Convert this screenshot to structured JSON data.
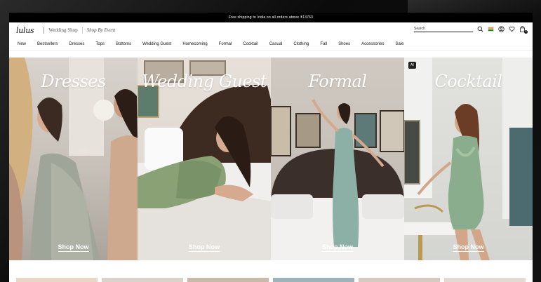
{
  "promo": {
    "text": "Free shipping to India on all orders above ₹13763"
  },
  "header": {
    "logo": "lulus",
    "links": [
      "Wedding Shop",
      "Shop By Event"
    ],
    "search_placeholder": "Search",
    "bag_count": "0"
  },
  "nav": {
    "items": [
      "New",
      "Bestsellers",
      "Dresses",
      "Tops",
      "Bottoms",
      "Wedding Guest",
      "Homecoming",
      "Formal",
      "Cocktail",
      "Casual",
      "Clothing",
      "Fall",
      "Shoes",
      "Accessories",
      "Sale"
    ]
  },
  "hero": {
    "panels": [
      {
        "title": "Dresses",
        "cta": "Shop Now",
        "bg": "#c9c4bd"
      },
      {
        "title": "Wedding Guest",
        "cta": "Shop Now",
        "bg": "#ddd6cf"
      },
      {
        "title": "Formal",
        "cta": "Shop Now",
        "bg": "#c2bcb4"
      },
      {
        "title": "Cocktail",
        "cta": "Shop Now",
        "bg": "#cfd2cf"
      }
    ],
    "ai_badge": "AI"
  },
  "colors": {
    "black": "#000000",
    "dress_green": "#8aa98a",
    "sage": "#9cb19b",
    "teal_dress": "#8fb0a8"
  }
}
